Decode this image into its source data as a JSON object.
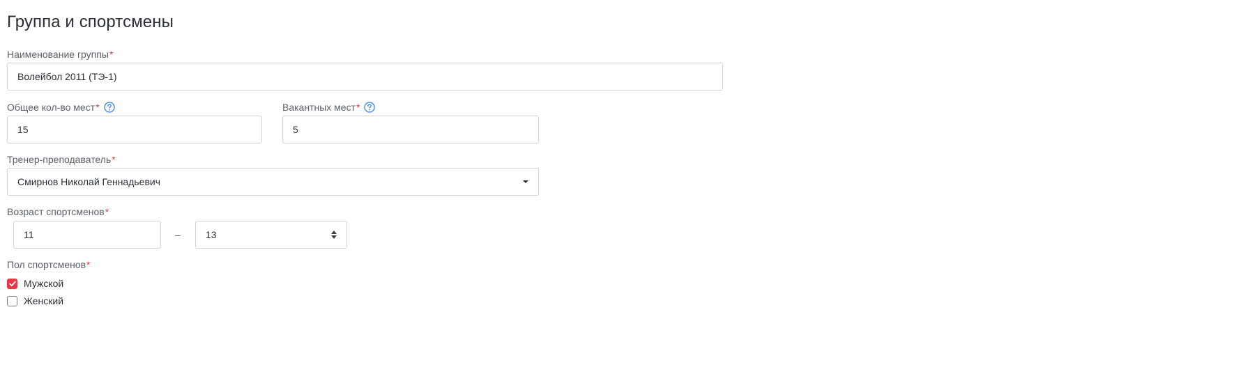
{
  "page": {
    "title": "Группа и спортсмены"
  },
  "group_name": {
    "label": "Наименование группы",
    "required_mark": "*",
    "value": "Волейбол 2011 (ТЭ-1)"
  },
  "total_places": {
    "label": "Общее кол-во мест",
    "required_mark": "*",
    "value": "15",
    "help_icon": "question-circle-icon"
  },
  "vacant_places": {
    "label": "Вакантных мест",
    "required_mark": "*",
    "value": "5",
    "help_icon": "question-circle-icon"
  },
  "coach": {
    "label": "Тренер-преподаватель",
    "required_mark": "*",
    "selected": "Смирнов Николай Геннадьевич",
    "dropdown_icon": "caret-down-icon"
  },
  "age": {
    "label": "Возраст спортсменов",
    "required_mark": "*",
    "from": "11",
    "separator": "–",
    "to": "13",
    "stepper_icon": "spinner-arrows-icon"
  },
  "gender": {
    "label": "Пол спортсменов",
    "required_mark": "*",
    "options": [
      {
        "label": "Мужской",
        "checked": true
      },
      {
        "label": "Женский",
        "checked": false
      }
    ]
  },
  "colors": {
    "accent_red": "#e53946",
    "help_blue": "#2f7ef1",
    "border": "#cfd3da",
    "label_text": "#5a5f69",
    "title_text": "#2a2e36"
  }
}
